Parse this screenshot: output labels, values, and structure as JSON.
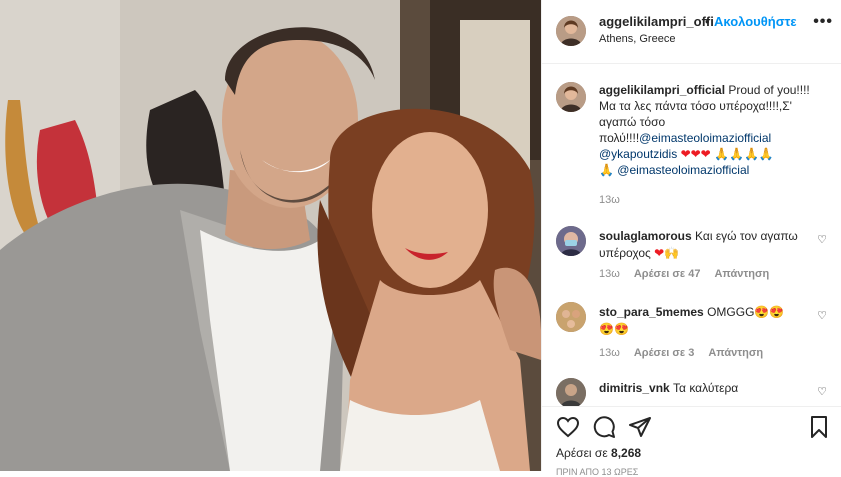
{
  "post": {
    "author": "aggelikilampri_offi",
    "dot": "•",
    "follow_label": "Ακολουθήστε",
    "location": "Athens, Greece",
    "more": "•••"
  },
  "caption": {
    "username": "aggelikilampri_official",
    "text_1": " Proud of you!!!!Μα τα λες πάντα τόσο υπέροχα!!!!,Σ' αγαπώ τόσο πολύ!!!!",
    "mention_1": "@eimasteoloimaziofficial",
    "mention_2": "@ykapoutzidis",
    "hearts": "❤❤❤",
    "hands": "🙏🙏🙏🙏",
    "hand_last": "🙏",
    "mention_3": "@eimasteoloimaziofficial",
    "time": "13ω"
  },
  "comments": [
    {
      "username": "soulaglamorous",
      "text": " Και εγώ τον αγαπω υπέροχος ",
      "emoji": "❤🙌",
      "time": "13ω",
      "likes": "Αρέσει σε 47",
      "reply": "Απάντηση"
    },
    {
      "username": "sto_para_5memes",
      "text": " OMGGG",
      "emoji": "😍😍😍😍",
      "time": "13ω",
      "likes": "Αρέσει σε 3",
      "reply": "Απάντηση"
    },
    {
      "username": "dimitris_vnk",
      "text": " Τα καλύτερα"
    }
  ],
  "actions": {
    "like_icon": "heart-outline",
    "comment_icon": "comment-bubble",
    "share_icon": "paper-plane",
    "save_icon": "bookmark",
    "likes_prefix": "Αρέσει σε ",
    "likes_count": "8,268",
    "date": "ΠΡΙΝ ΑΠΟ 13 ΩΡΕΣ"
  },
  "colors": {
    "link_blue": "#0095f6",
    "mention": "#00376b",
    "muted": "#8e8e8e",
    "heart_red": "#ed1c24"
  }
}
